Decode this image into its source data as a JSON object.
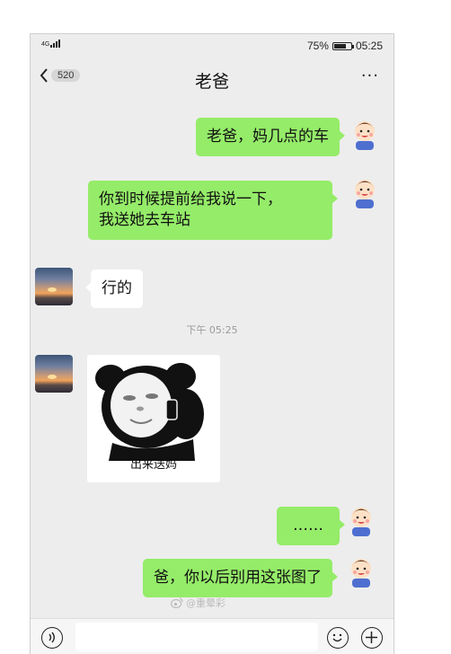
{
  "status_bar": {
    "network": "4G",
    "battery": "75%",
    "battery_level": 0.75,
    "time": "05:25"
  },
  "nav": {
    "unread_count": "520",
    "title": "老爸",
    "more": "···"
  },
  "messages": [
    {
      "from": "me",
      "text": "老爸，妈几点的车"
    },
    {
      "from": "me",
      "text": "你到时候提前给我说一下，\n我送她去车站"
    },
    {
      "from": "other",
      "text": "行的"
    },
    {
      "from": "me",
      "text": "……"
    },
    {
      "from": "me",
      "text": "爸，你以后别用这张图了"
    }
  ],
  "timestamp": "下午 05:25",
  "sticker": {
    "caption": "出来送妈"
  },
  "watermark": "@重晕彩"
}
